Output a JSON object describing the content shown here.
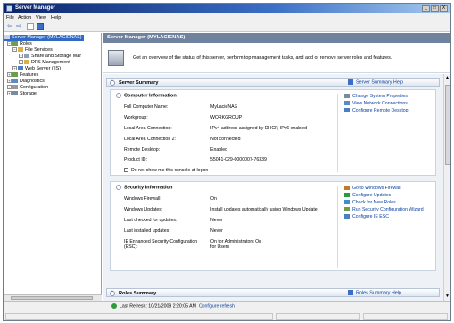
{
  "window": {
    "title": "Server Manager",
    "controls": {
      "minimize": "_",
      "maximize": "□",
      "close": "X"
    }
  },
  "menu": [
    "File",
    "Action",
    "View",
    "Help"
  ],
  "toolbar": {
    "back_icon": "back-arrow-icon",
    "forward_icon": "forward-arrow-icon",
    "show_hide_icon": "console-tree-icon",
    "help_icon": "help-icon"
  },
  "tree": {
    "root": "Server Manager (MYLACIENAS)",
    "roles": "Roles",
    "file_services": "File Services",
    "share_storage": "Share and Storage Mar",
    "dfs": "DFS Management",
    "web_server": "Web Server (IIS)",
    "features": "Features",
    "diagnostics": "Diagnostics",
    "configuration": "Configuration",
    "storage": "Storage"
  },
  "main": {
    "header": "Server Manager (MYLACIENAS)",
    "intro": "Get an overview of the status of this server, perform top management tasks, and add or remove server roles and features."
  },
  "server_summary": {
    "title": "Server Summary",
    "help": "Server Summary Help",
    "computer_info": {
      "title": "Computer Information",
      "rows": [
        {
          "label": "Full Computer Name:",
          "value": "MyLacieNAS"
        },
        {
          "label": "Workgroup:",
          "value": "WORKGROUP"
        },
        {
          "label": "Local Area Connection:",
          "value": "IPv4 address assigned by DHCP, IPv6 enabled"
        },
        {
          "label": "Local Area Connection 2:",
          "value": "Not connected"
        },
        {
          "label": "Remote Desktop:",
          "value": "Enabled"
        },
        {
          "label": "Product ID:",
          "value": "55041-029-0000007-76339"
        }
      ],
      "checkbox": "Do not show me this console at logon",
      "tasks": [
        "Change System Properties",
        "View Network Connections",
        "Configure Remote Desktop"
      ]
    },
    "security_info": {
      "title": "Security Information",
      "rows": [
        {
          "label": "Windows Firewall:",
          "value": "On"
        },
        {
          "label": "Windows Updates:",
          "value": "Install updates automatically using Windows Update"
        },
        {
          "label": "Last checked for updates:",
          "value": "Never"
        },
        {
          "label": "Last installed updates:",
          "value": "Never"
        },
        {
          "label": "IE Enhanced Security Configuration (ESC):",
          "value": "On for Administrators On for Users"
        }
      ],
      "tasks": [
        "Go to Windows Firewall",
        "Configure Updates",
        "Check for New Roles",
        "Run Security Configuration Wizard",
        "Configure IE ESC"
      ]
    }
  },
  "roles_summary": {
    "title": "Roles Summary",
    "help": "Roles Summary Help"
  },
  "status": {
    "text": "Last Refresh: 10/21/2009 2:20:05 AM",
    "link": "Configure refresh"
  },
  "colors": {
    "title_start": "#0a246a",
    "header": "#6f829e",
    "link": "#0a3f9e",
    "selection": "#316ac5"
  }
}
